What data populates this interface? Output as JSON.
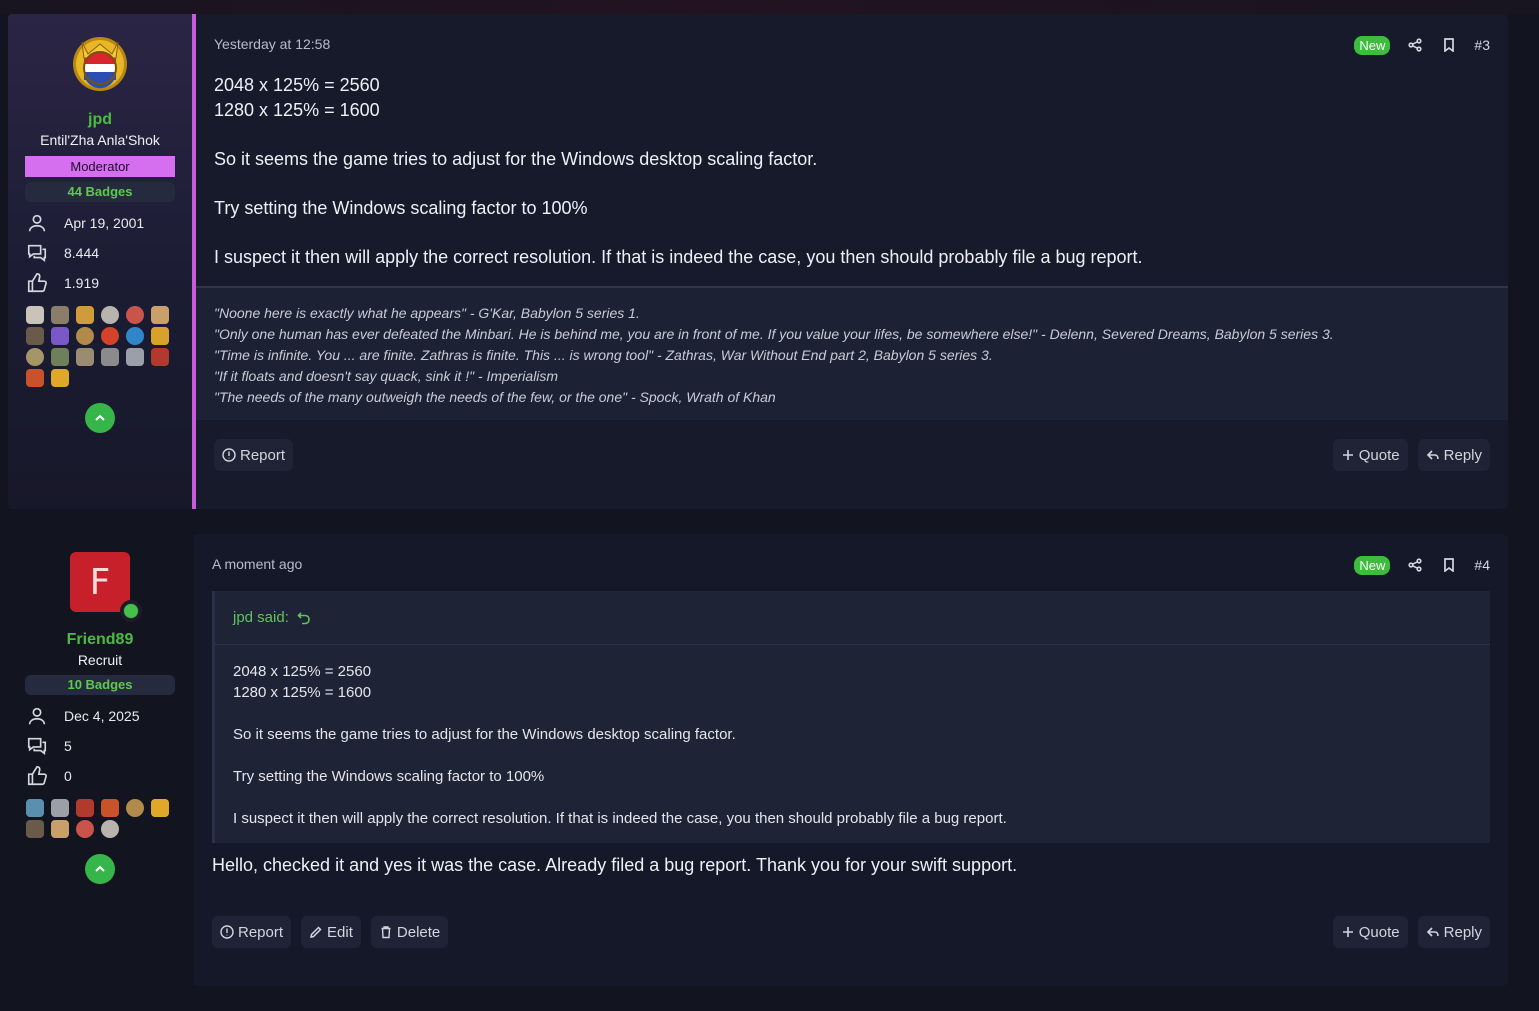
{
  "posts": [
    {
      "user": {
        "name": "jpd",
        "title": "Entil'Zha Anla'Shok",
        "role": "Moderator",
        "badges": "44 Badges",
        "joined": "Apr 19, 2001",
        "messages": "8.444",
        "reactions": "1.919"
      },
      "timestamp": "Yesterday at 12:58",
      "new_label": "New",
      "number": "#3",
      "body": [
        "2048 x 125% = 2560",
        "1280 x 125% = 1600",
        "So it seems the game tries to adjust for the Windows desktop scaling factor.",
        "Try setting the Windows scaling factor to 100%",
        "I suspect it then will apply the correct resolution. If that is indeed the case, you then should probably file a bug report."
      ],
      "signature": [
        "\"Noone here is exactly what he appears\" - G'Kar, Babylon 5 series 1.",
        "\"Only one human has ever defeated the Minbari. He is behind me, you are in front of me. If you value your lifes, be somewhere else!\" - Delenn, Severed Dreams, Babylon 5 series 3.",
        "\"Time is infinite. You ... are finite. Zathras is finite. This ... is wrong tool\" - Zathras, War Without End part 2, Babylon 5 series 3.",
        "\"If it floats and doesn't say quack, sink it !\" - Imperialism",
        "\"The needs of the many outweigh the needs of the few, or the one\" - Spock, Wrath of Khan"
      ],
      "actions": {
        "report": "Report",
        "quote": "Quote",
        "reply": "Reply"
      }
    },
    {
      "user": {
        "name": "Friend89",
        "avatar_letter": "F",
        "title": "Recruit",
        "badges": "10 Badges",
        "joined": "Dec 4, 2025",
        "messages": "5",
        "reactions": "0"
      },
      "timestamp": "A moment ago",
      "new_label": "New",
      "number": "#4",
      "quote": {
        "author": "jpd said:",
        "lines": [
          "2048 x 125% = 2560",
          "1280 x 125% = 1600",
          "So it seems the game tries to adjust for the Windows desktop scaling factor.",
          "Try setting the Windows scaling factor to 100%",
          "I suspect it then will apply the correct resolution. If that is indeed the case, you then should probably file a bug report."
        ]
      },
      "body": "Hello, checked it and yes it was the case. Already filed a bug report. Thank you for your swift support.",
      "actions": {
        "report": "Report",
        "edit": "Edit",
        "delete": "Delete",
        "quote": "Quote",
        "reply": "Reply"
      }
    }
  ],
  "colors": {
    "background": "#12141f",
    "username": "#4cbc3f",
    "moderator_banner": "#d66ef0",
    "new_badge": "#3cbd3c",
    "accent_border": "#c75bdc"
  },
  "icons": [
    "user-icon",
    "messages-icon",
    "thumbs-up-icon",
    "share-icon",
    "bookmark-icon",
    "chevron-up-icon",
    "report-icon",
    "plus-icon",
    "reply-arrow-icon",
    "edit-icon",
    "trash-icon",
    "quote-jump-icon"
  ]
}
